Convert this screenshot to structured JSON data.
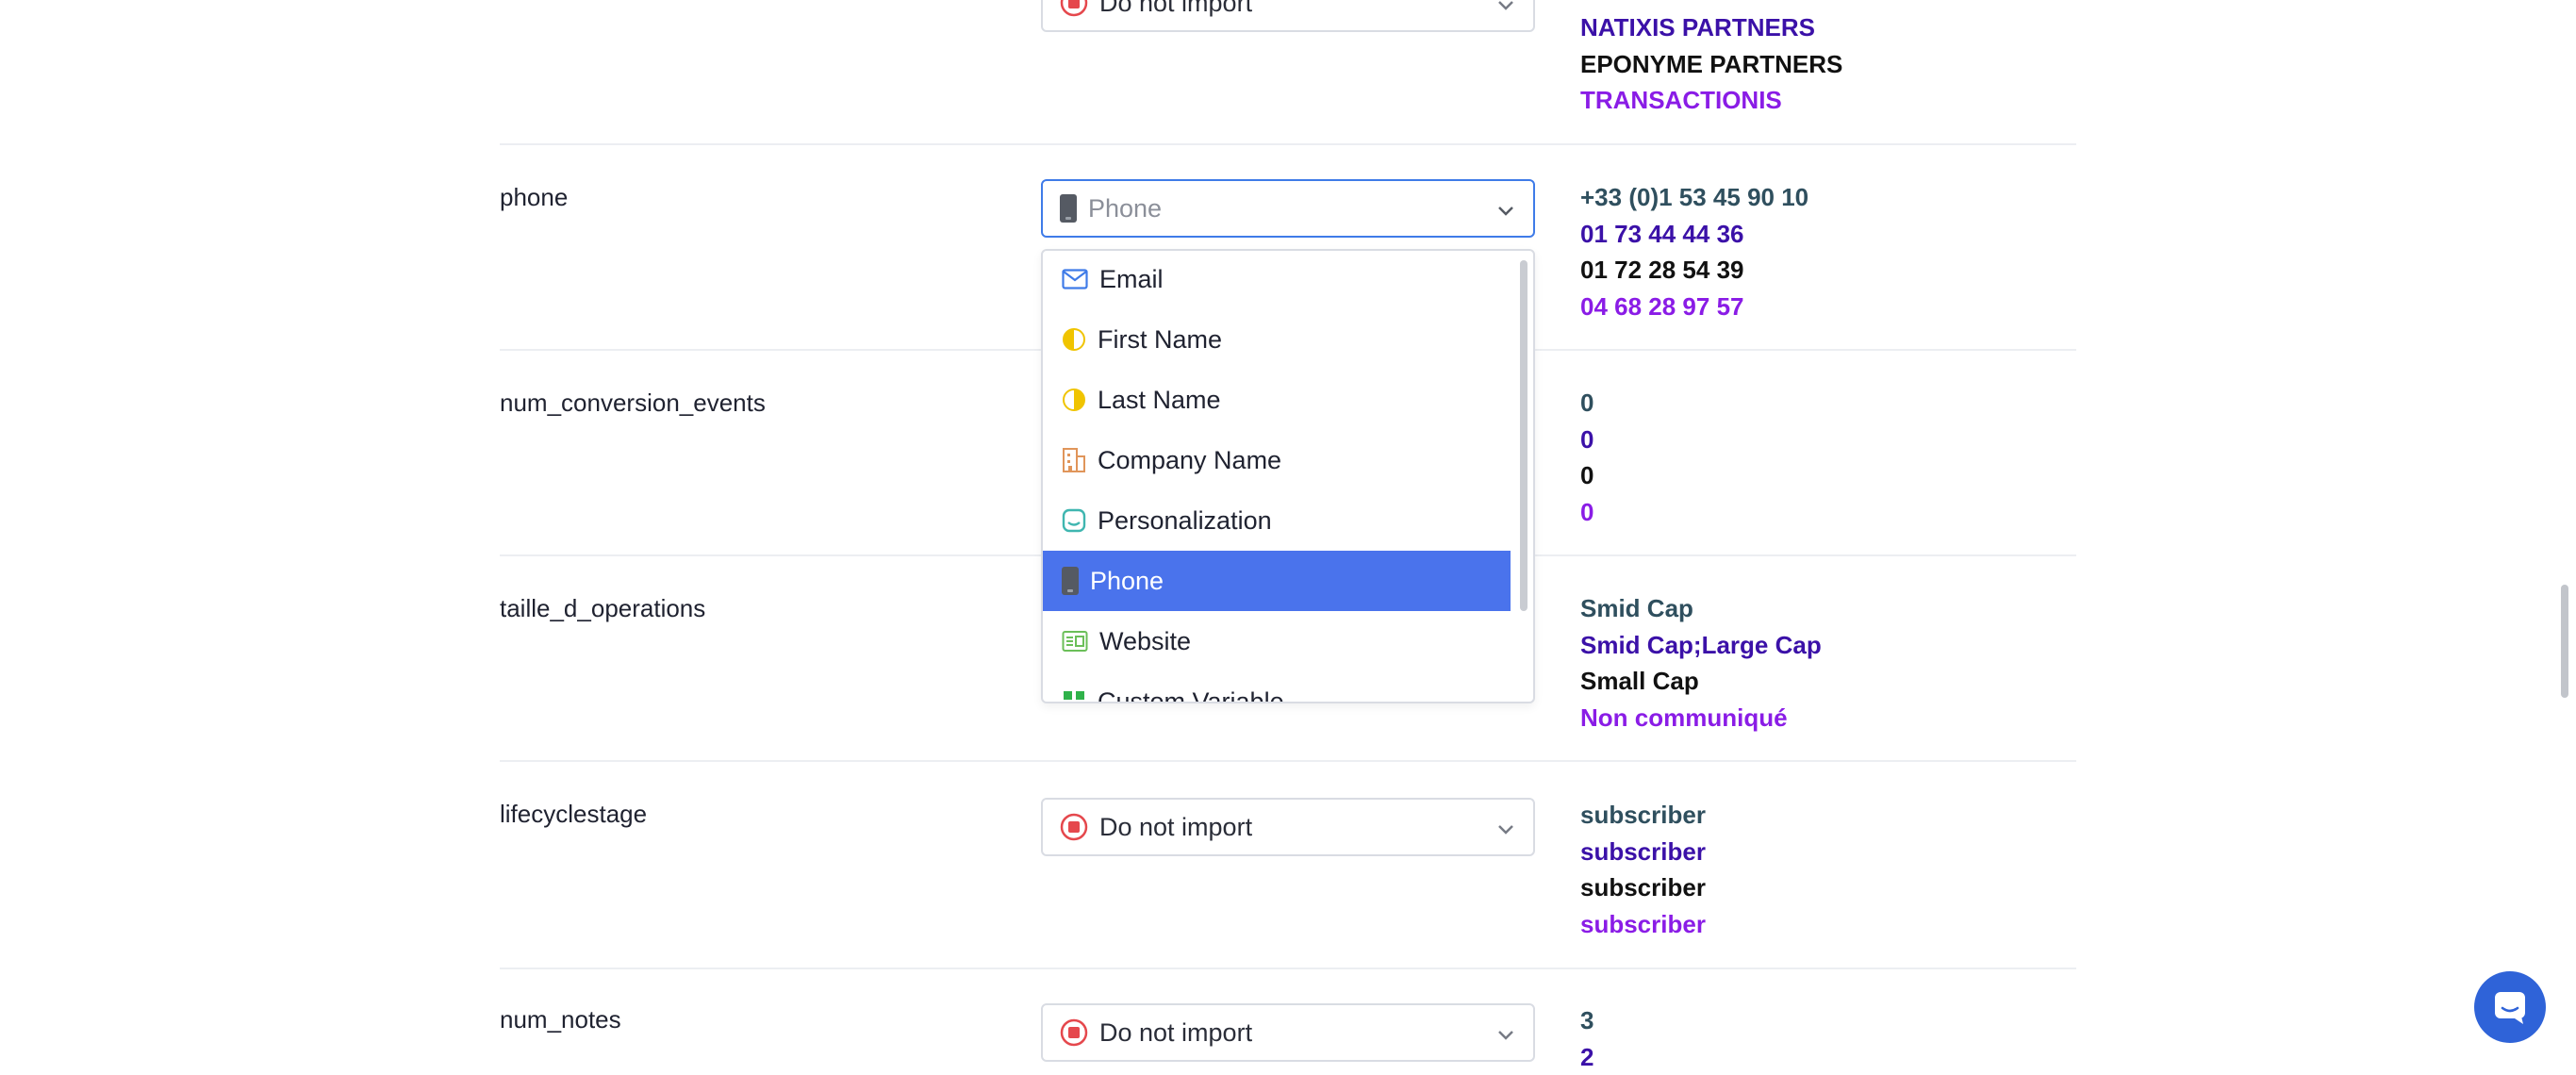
{
  "top_row": {
    "select_label": "Do not import",
    "values": [
      "NATIXIS PARTNERS",
      "EPONYME PARTNERS",
      "TRANSACTIONIS"
    ]
  },
  "rows": [
    {
      "name": "phone",
      "select_label": "Phone",
      "values": [
        "+33 (0)1 53 45 90 10",
        "01 73 44 44 36",
        "01 72 28 54 39",
        "04 68 28 97 57"
      ]
    },
    {
      "name": "num_conversion_events",
      "values": [
        "0",
        "0",
        "0",
        "0"
      ]
    },
    {
      "name": "taille_d_operations",
      "values": [
        "Smid Cap",
        "Smid Cap;Large Cap",
        "Small Cap",
        "Non communiqué"
      ]
    },
    {
      "name": "lifecyclestage",
      "select_label": "Do not import",
      "values": [
        "subscriber",
        "subscriber",
        "subscriber",
        "subscriber"
      ]
    },
    {
      "name": "num_notes",
      "select_label": "Do not import",
      "values": [
        "3",
        "2"
      ]
    }
  ],
  "dropdown": {
    "options": [
      "Email",
      "First Name",
      "Last Name",
      "Company Name",
      "Personalization",
      "Phone",
      "Website",
      "Custom Variable"
    ],
    "selected": "Phone"
  },
  "icons": {
    "do_not_import": "stop-icon",
    "email": "envelope-icon",
    "first_name": "half-circle-icon",
    "last_name": "half-circle-icon",
    "company": "building-icon",
    "personalization": "message-icon",
    "phone": "phone-icon",
    "website": "website-icon",
    "custom_variable": "grid-icon",
    "chat": "chat-icon"
  },
  "colors": {
    "accent": "#4a73ec",
    "value_1": "#2f4f5e",
    "value_2": "#3b11a8",
    "value_3": "#111111",
    "value_4": "#8a1ce6",
    "stop_red": "#e5484d",
    "chat_blue": "#2f63d8"
  }
}
